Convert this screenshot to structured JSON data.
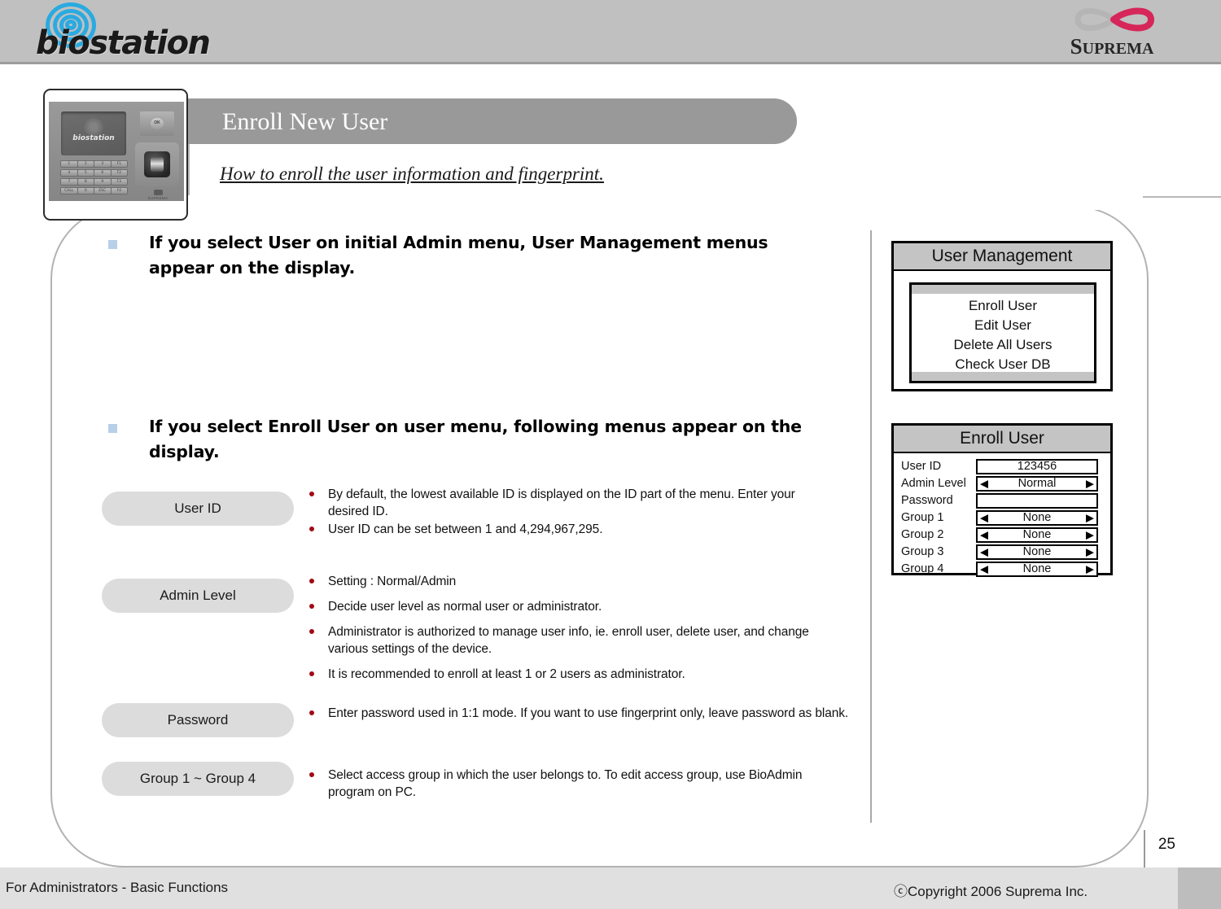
{
  "header": {
    "logo_left": "biostation",
    "logo_right": "SUPREMA",
    "logo_right_initial": "S",
    "logo_right_rest": "UPREMA"
  },
  "device": {
    "screen_label": "biostation",
    "dpad_ok": "OK",
    "brand": "SUPREMA",
    "keys": [
      [
        "1",
        "2",
        "3",
        "F1"
      ],
      [
        "4",
        "5",
        "6",
        "F2"
      ],
      [
        "7",
        "8",
        "9",
        "F3"
      ],
      [
        "CALL",
        "0",
        "ESC",
        "F4"
      ]
    ]
  },
  "title": {
    "heading": "Enroll New User",
    "subtitle": "How to enroll the user information and fingerprint."
  },
  "statements": [
    "If you select User on initial Admin menu, User Management menus appear on the display.",
    "If you select Enroll User on user menu, following menus appear on the display."
  ],
  "sections": [
    {
      "pill": "User ID",
      "bullets": [
        "By default, the lowest available ID is displayed on the ID part of the menu. Enter your desired ID.",
        "User ID can be set between 1 and 4,294,967,295."
      ]
    },
    {
      "pill": "Admin Level",
      "bullets": [
        "Setting : Normal/Admin",
        "Decide user level as normal user or administrator.",
        "Administrator is authorized to manage user info, ie. enroll user, delete user, and change various settings of the device.",
        "It is recommended to enroll at least 1 or 2 users as administrator."
      ]
    },
    {
      "pill": "Password",
      "bullets": [
        "Enter password used in 1:1 mode. If you want to use fingerprint only, leave password as blank."
      ]
    },
    {
      "pill": "Group 1 ~ Group 4",
      "bullets": [
        "Select access group in which the user belongs to. To edit access group, use BioAdmin program on PC."
      ]
    }
  ],
  "user_management_panel": {
    "title": "User Management",
    "items": [
      "Enroll User",
      "Edit User",
      "Delete All Users",
      "Check User DB"
    ]
  },
  "enroll_user_panel": {
    "title": "Enroll User",
    "rows": [
      {
        "label": "User ID",
        "value": "123456",
        "arrows": false
      },
      {
        "label": "Admin Level",
        "value": "Normal",
        "arrows": true
      },
      {
        "label": "Password",
        "value": "",
        "arrows": false
      },
      {
        "label": "Group 1",
        "value": "None",
        "arrows": true
      },
      {
        "label": "Group 2",
        "value": "None",
        "arrows": true
      },
      {
        "label": "Group 3",
        "value": "None",
        "arrows": true
      },
      {
        "label": "Group 4",
        "value": "None",
        "arrows": true
      }
    ],
    "arrow_left": "◀",
    "arrow_right": "▶"
  },
  "footer": {
    "left": "For Administrators - Basic Functions",
    "copyright": "ⓒCopyright 2006 Suprema Inc.",
    "page_number": "25"
  },
  "colors": {
    "header_band": "#c0c0c0",
    "title_bar": "#999999",
    "pill": "#dcdcdc",
    "bullet_square": "#b8cfe8",
    "bullet_dot": "#a00a14",
    "panel_title": "#c4c4c4",
    "logo_blue": "#2aaae1",
    "suprema_red": "#d6265a"
  }
}
